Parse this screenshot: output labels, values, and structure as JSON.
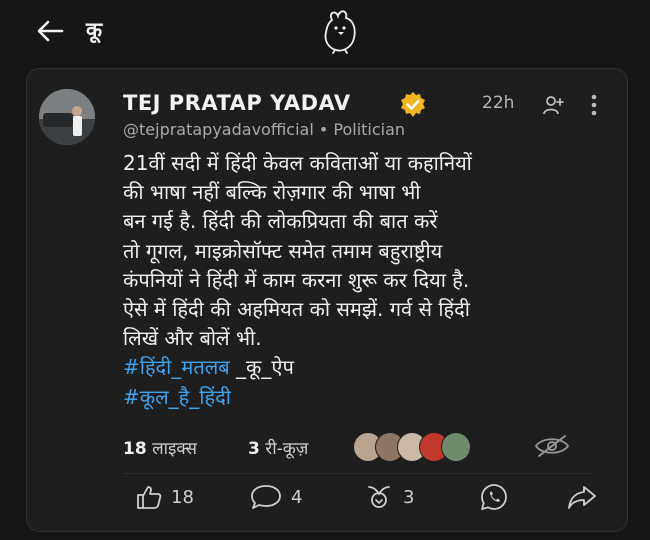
{
  "app": {
    "title": "कू"
  },
  "post": {
    "author_name": "TEJ PRATAP YADAV",
    "time": "22h",
    "handle": "@tejpratapyadavofficial • Politician",
    "lines": [
      "21वीं सदी में हिंदी केवल कविताओं या कहानियों",
      "की भाषा नहीं बल्कि रोज़गार की भाषा भी",
      "बन गई है. हिंदी की लोकप्रियता की बात करें",
      "तो गूगल, माइक्रोसॉफ्ट समेत तमाम बहुराष्ट्रीय",
      "कंपनियों ने हिंदी में काम करना शुरू कर दिया है.",
      "ऐसे में हिंदी की अहमियत को समझें. गर्व से हिंदी",
      "लिखें और बोलें भी."
    ],
    "hashtag1": "#हिंदी_मतलब",
    "hashtag1_suffix": " _कू_ऐप",
    "hashtag2": "#कूल_है_हिंदी"
  },
  "stats": {
    "likes_count": "18",
    "likes_label": " लाइक्स",
    "rekoos_count": "3",
    "rekoos_label": " री-कूज़"
  },
  "actions": {
    "like_count": "18",
    "comment_count": "4",
    "rekoo_count": "3"
  },
  "colors": {
    "background": "#161616",
    "card": "#1e1e1e",
    "hashtag": "#3ea3ee",
    "verified": "#f2b51f"
  },
  "icons": [
    "back-arrow-icon",
    "koo-bird-logo-icon",
    "verified-badge-icon",
    "follow-user-icon",
    "more-vertical-icon",
    "eye-off-icon",
    "thumbs-up-icon",
    "comment-icon",
    "rekoo-icon",
    "whatsapp-icon",
    "share-icon"
  ]
}
